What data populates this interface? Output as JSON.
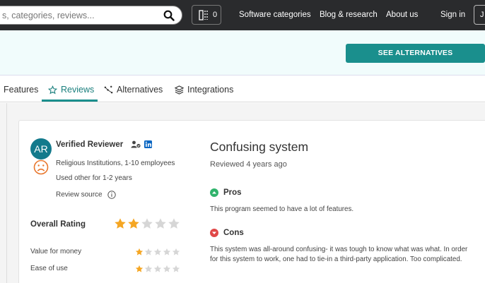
{
  "topnav": {
    "search_placeholder": "s, categories, reviews...",
    "compare_count": "0",
    "links": [
      "Software categories",
      "Blog & research",
      "About us",
      "Sign in"
    ],
    "account_initial": "J"
  },
  "subheader": {
    "alternatives_button": "SEE ALTERNATIVES"
  },
  "tabs": [
    {
      "label": "Features",
      "icon": ""
    },
    {
      "label": "Reviews",
      "icon": "star-outline-icon"
    },
    {
      "label": "Alternatives",
      "icon": "scatter-icon"
    },
    {
      "label": "Integrations",
      "icon": "layers-icon"
    }
  ],
  "reviewer": {
    "initials": "AR",
    "name": "Verified Reviewer",
    "industry": "Religious Institutions, 1-10 employees",
    "usage": "Used other for 1-2 years",
    "source": "Review source",
    "sentiment_icon": "sad-face-icon"
  },
  "ratings": {
    "overall_label": "Overall Rating",
    "overall_value": 2,
    "items": [
      {
        "label": "Value for money",
        "value": 1
      },
      {
        "label": "Ease of use",
        "value": 1
      }
    ]
  },
  "review": {
    "title": "Confusing system",
    "date": "Reviewed 4 years ago",
    "pros_label": "Pros",
    "pros_text": "This program seemed to have a lot of features.",
    "cons_label": "Cons",
    "cons_text": "This system was all-around confusing- it was tough to know what was what. In order for this system to work, one had to tie-in a third-party application. Too complicated."
  },
  "colors": {
    "nav_bg": "#2a2b2d",
    "accent": "#1a8f8d",
    "star": "#f5a623",
    "pros": "#2fb36b",
    "cons": "#e04848"
  }
}
